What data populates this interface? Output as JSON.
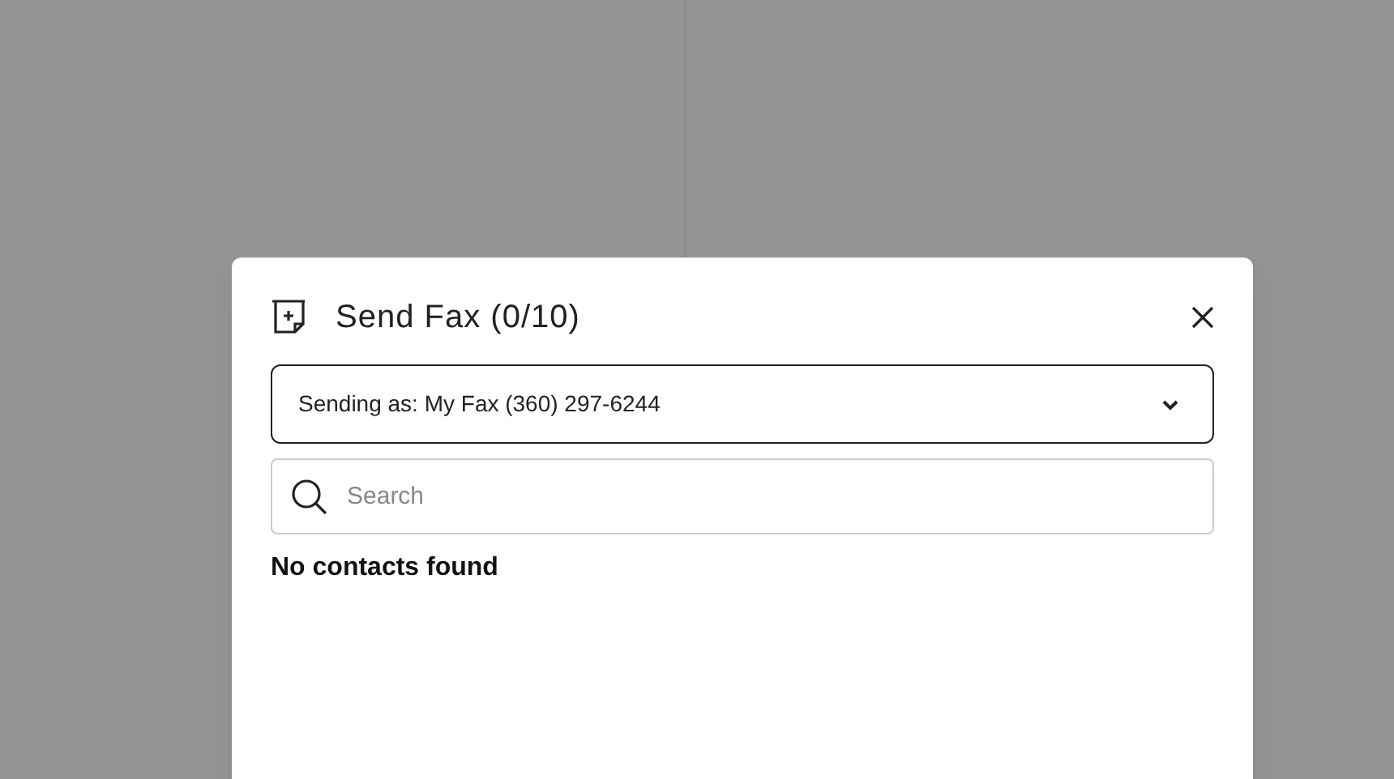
{
  "dialog": {
    "title": "Send Fax (0/10)",
    "sender_select": {
      "value": "Sending as: My Fax (360) 297-6244"
    },
    "search": {
      "placeholder": "Search"
    },
    "empty_message": "No contacts found"
  }
}
